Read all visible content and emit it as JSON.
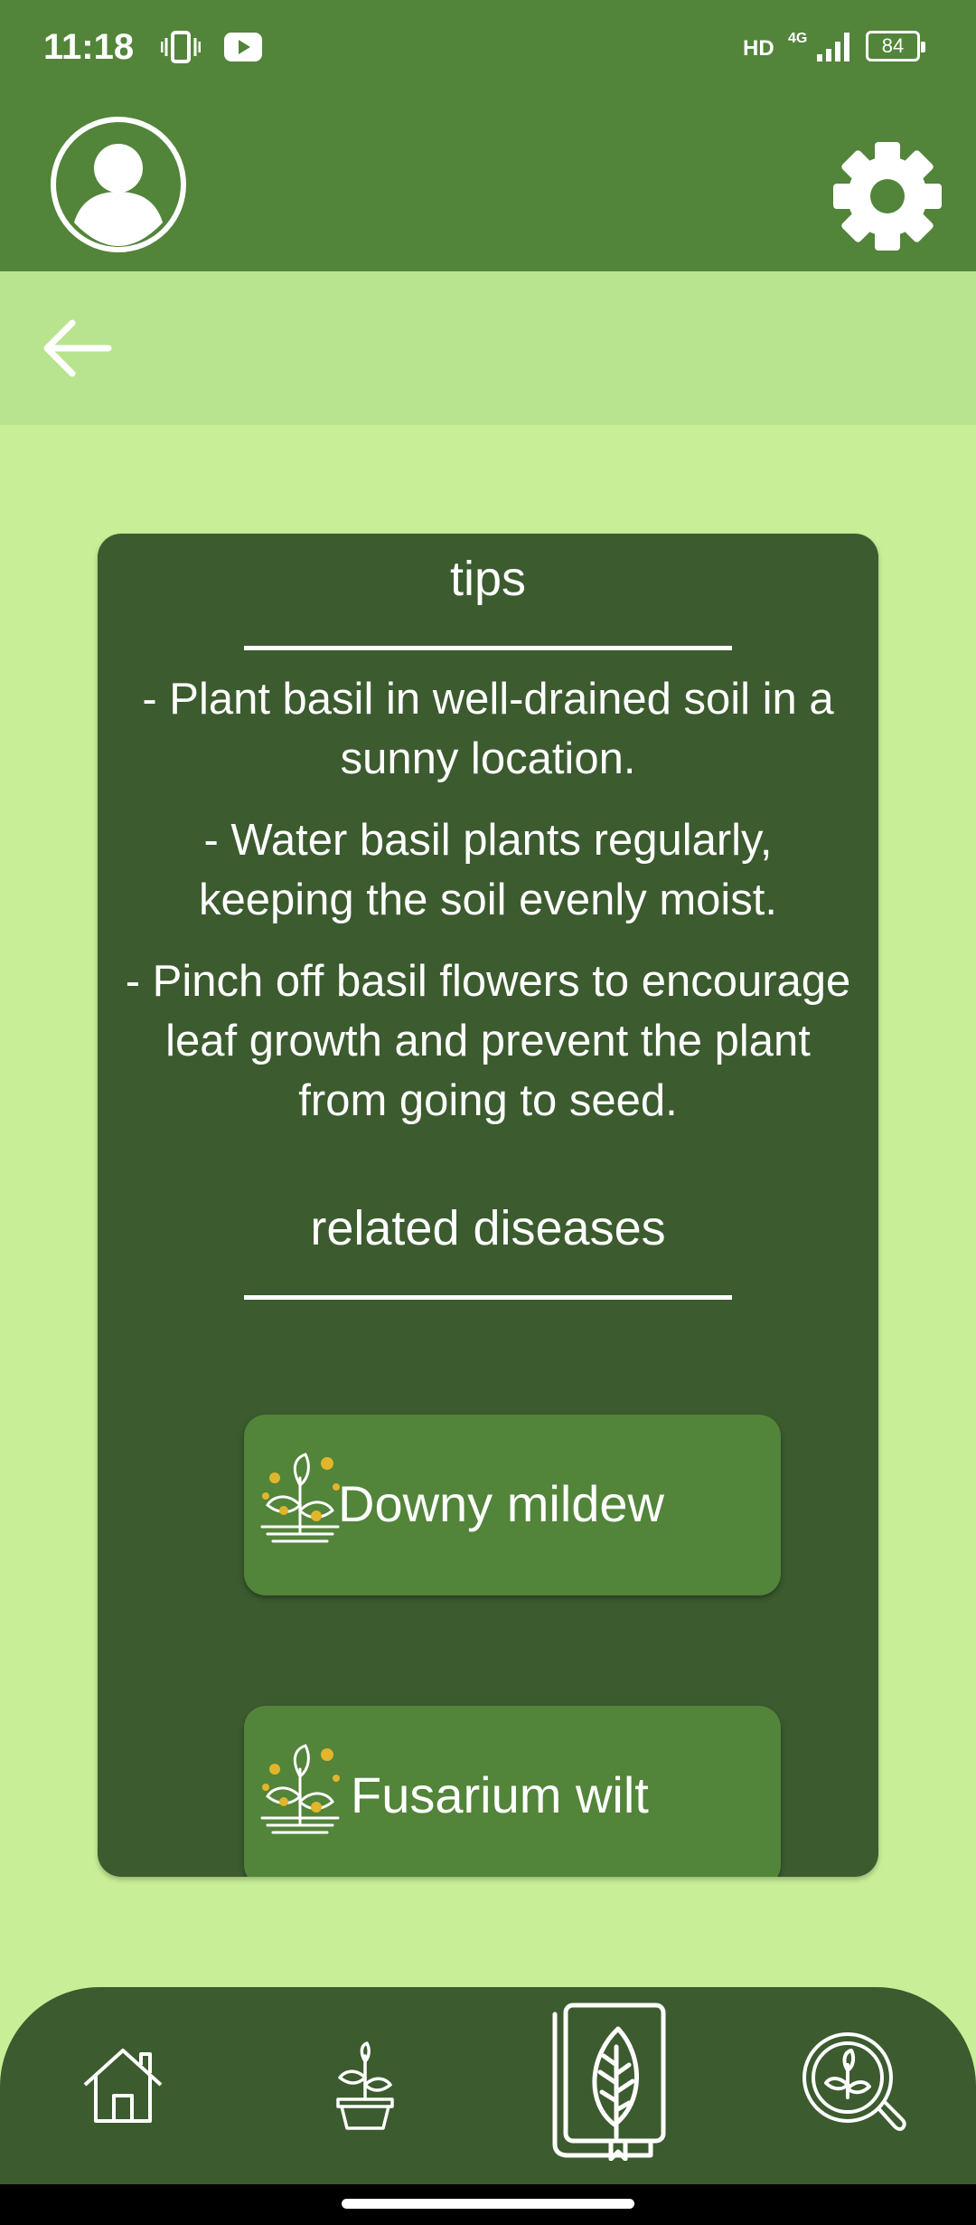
{
  "status_bar": {
    "time": "11:18",
    "network_type": "HD",
    "signal_label": "4G",
    "battery": "84",
    "icons": [
      "vibrate-icon",
      "youtube-icon",
      "signal-icon",
      "battery-icon"
    ]
  },
  "app_bar": {
    "icons": [
      "avatar-icon",
      "gear-icon"
    ],
    "back_icon": "arrow-left-icon"
  },
  "card": {
    "tips_heading": "tips",
    "tips": [
      "- Plant basil in well-drained soil in a sunny location.",
      "- Water basil plants regularly, keeping the soil evenly moist.",
      "- Pinch off basil flowers to encourage leaf growth and prevent the plant from going to seed."
    ],
    "diseases_heading": "related diseases",
    "diseases": [
      {
        "name": "Downy mildew",
        "icon": "diseased-plant-icon"
      },
      {
        "name": "Fusarium wilt",
        "icon": "diseased-plant-icon"
      }
    ]
  },
  "bottom_nav": {
    "items": [
      "home-icon",
      "potted-plant-icon",
      "leaf-book-icon",
      "plant-search-icon"
    ],
    "active": "leaf-book-icon"
  },
  "colors": {
    "primary": "#52843a",
    "dark": "#3c5b2f",
    "background": "#c8ef98",
    "subbar": "#b9e48f",
    "disease_dot": "#e2b52a"
  }
}
